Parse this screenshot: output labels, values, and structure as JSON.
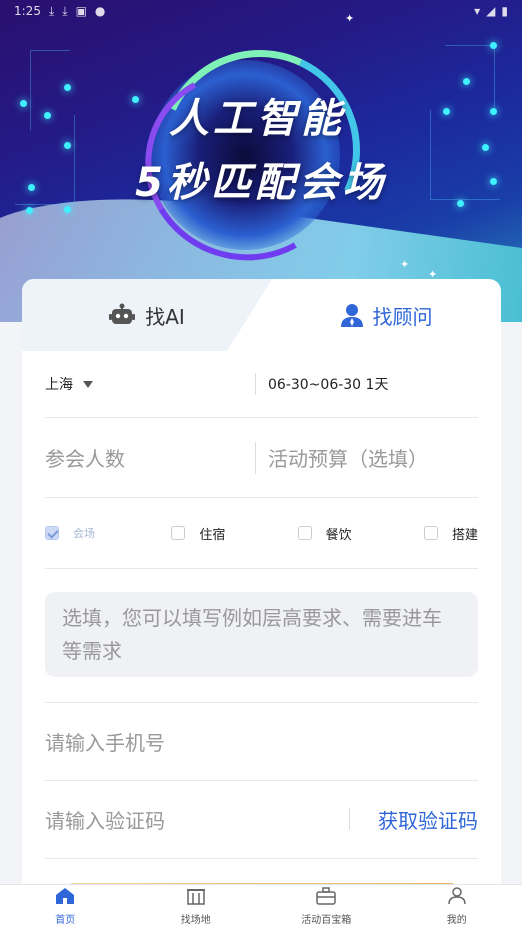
{
  "status_bar": {
    "time": "1:25"
  },
  "hero": {
    "line1": "人工智能",
    "line2": "5秒匹配会场"
  },
  "tabs": [
    {
      "label": "找AI",
      "icon": "robot-icon",
      "active": false
    },
    {
      "label": "找顾问",
      "icon": "consultant-icon",
      "active": true
    }
  ],
  "form": {
    "city": "上海",
    "date_range": "06-30~06-30 1天",
    "attendees_placeholder": "参会人数",
    "budget_placeholder": "活动预算（选填）",
    "options": [
      {
        "label": "会场",
        "checked": true
      },
      {
        "label": "住宿",
        "checked": false
      },
      {
        "label": "餐饮",
        "checked": false
      },
      {
        "label": "搭建",
        "checked": false
      }
    ],
    "remark_placeholder": "选填，您可以填写例如层高要求、需要进车等需求",
    "phone_placeholder": "请输入手机号",
    "code_placeholder": "请输入验证码",
    "get_code_label": "获取验证码"
  },
  "bottom_nav": [
    {
      "label": "首页",
      "icon": "home-icon",
      "active": true
    },
    {
      "label": "找场地",
      "icon": "venue-icon",
      "active": false
    },
    {
      "label": "活动百宝箱",
      "icon": "toolbox-icon",
      "active": false
    },
    {
      "label": "我的",
      "icon": "profile-icon",
      "active": false
    }
  ],
  "colors": {
    "accent": "#2f66d8",
    "hero_dark": "#241a86",
    "hero_cyan": "#3ff0ff"
  }
}
